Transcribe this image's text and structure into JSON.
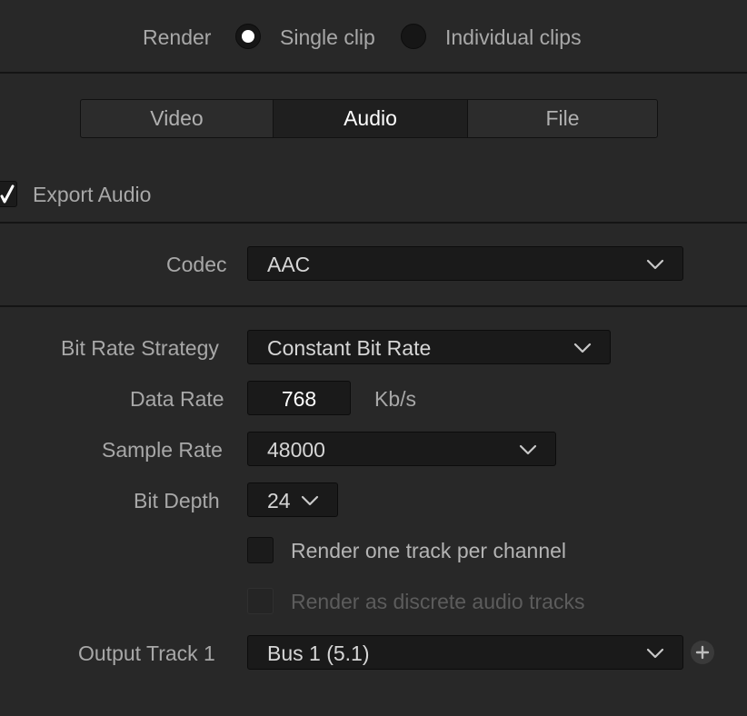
{
  "render": {
    "label": "Render",
    "options": [
      {
        "label": "Single clip",
        "selected": true
      },
      {
        "label": "Individual clips",
        "selected": false
      }
    ]
  },
  "tabs": [
    {
      "label": "Video",
      "active": false
    },
    {
      "label": "Audio",
      "active": true
    },
    {
      "label": "File",
      "active": false
    }
  ],
  "export_audio": {
    "label": "Export Audio",
    "checked": true
  },
  "codec": {
    "label": "Codec",
    "value": "AAC"
  },
  "bit_rate_strategy": {
    "label": "Bit Rate Strategy",
    "value": "Constant Bit Rate"
  },
  "data_rate": {
    "label": "Data Rate",
    "value": "768",
    "unit": "Kb/s"
  },
  "sample_rate": {
    "label": "Sample Rate",
    "value": "48000"
  },
  "bit_depth": {
    "label": "Bit Depth",
    "value": "24"
  },
  "render_one_track": {
    "label": "Render one track per channel",
    "checked": false
  },
  "render_discrete": {
    "label": "Render as discrete audio tracks",
    "checked": false,
    "disabled": true
  },
  "output_track": {
    "label": "Output Track 1",
    "value": "Bus 1 (5.1)"
  },
  "icons": {
    "chevron": "chevron-down-icon",
    "check": "checkmark-icon",
    "add": "plus-icon"
  },
  "colors": {
    "background": "#282828",
    "field": "#1a1a1a",
    "active_tab": "#1f1f1f",
    "label_text": "#a8a8a8",
    "value_text": "#d6d6d6"
  }
}
